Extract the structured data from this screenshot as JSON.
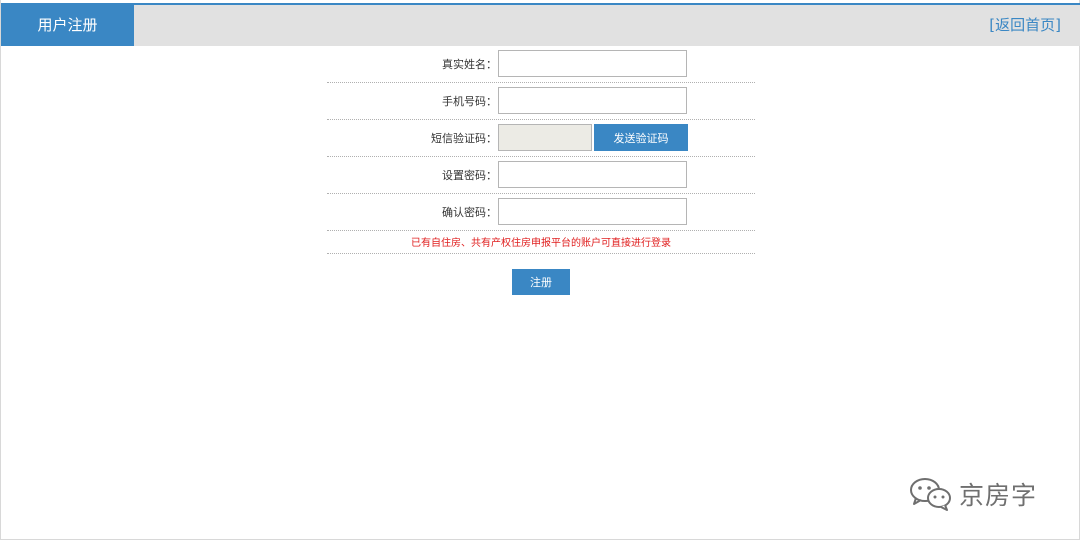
{
  "header": {
    "title": "用户注册",
    "back_link": "[返回首页]"
  },
  "form": {
    "fields": [
      {
        "label": "真实姓名：",
        "value": "",
        "placeholder": ""
      },
      {
        "label": "手机号码：",
        "value": "",
        "placeholder": ""
      },
      {
        "label": "短信验证码：",
        "value": "",
        "placeholder": ""
      },
      {
        "label": "设置密码：",
        "value": "",
        "placeholder": ""
      },
      {
        "label": "确认密码：",
        "value": "",
        "placeholder": ""
      }
    ],
    "send_code_label": "发送验证码",
    "notice": "已有自住房、共有产权住房申报平台的账户可直接进行登录",
    "submit_label": "注册"
  },
  "watermark": {
    "text": "京房字",
    "icon": "wechat-icon"
  },
  "colors": {
    "accent": "#3a87c4",
    "header_bg": "#e1e1e1",
    "notice": "#e02020",
    "disabled_input": "#ecebe5"
  }
}
